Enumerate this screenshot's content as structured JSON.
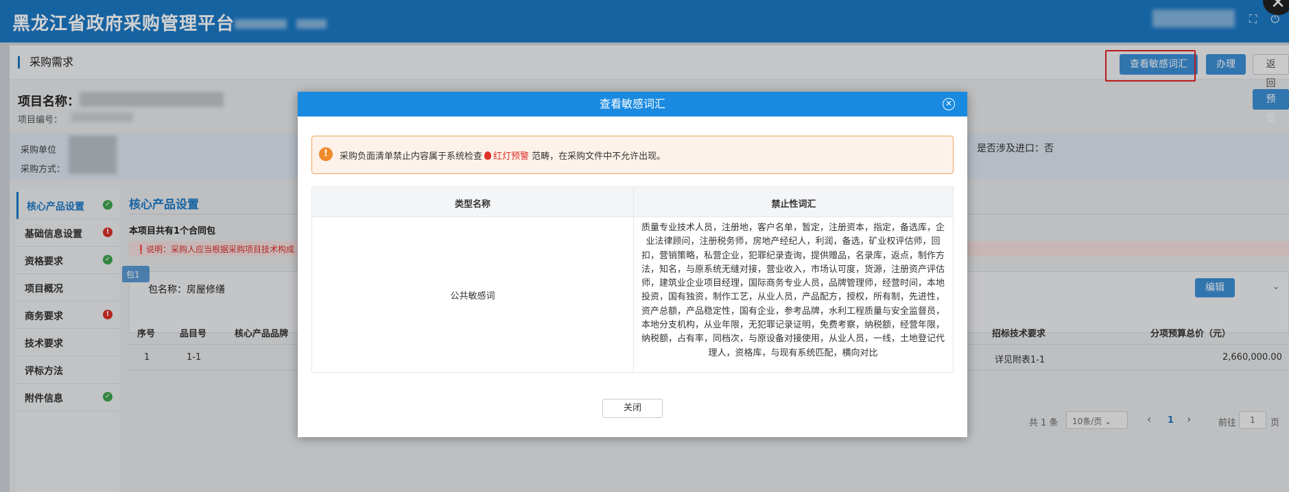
{
  "header": {
    "app_title": "黑龙江省政府采购管理平台",
    "icons": [
      "fullscreen-icon",
      "power-icon"
    ]
  },
  "page": {
    "card_title": "采购需求",
    "btn_view_sensitive": "查看敏感词汇",
    "btn_handle": "办理",
    "btn_back": "返回",
    "btn_preview": "预览",
    "project_name_label": "项目名称：",
    "project_code_label": "项目编号：",
    "purchase_unit_label": "采购单位",
    "purchase_method_label": "采购方式：",
    "import_text": "是否涉及进口：否"
  },
  "sidebar": {
    "items": [
      {
        "label": "核心产品设置",
        "status": "ok"
      },
      {
        "label": "基础信息设置",
        "status": "error"
      },
      {
        "label": "资格要求",
        "status": "ok"
      },
      {
        "label": "项目概况",
        "status": "none"
      },
      {
        "label": "商务要求",
        "status": "error"
      },
      {
        "label": "技术要求",
        "status": "none"
      },
      {
        "label": "评标方法",
        "status": "none"
      },
      {
        "label": "附件信息",
        "status": "ok"
      }
    ]
  },
  "main": {
    "section_title": "核心产品设置",
    "package_count": "本项目共有1个合同包",
    "warning": "说明：采购人应当根据采购项目技术构成",
    "package_tag": "包1",
    "package_name": "包名称：房屋修缮",
    "btn_edit": "编辑",
    "table": {
      "headers": [
        "序号",
        "品目号",
        "核心产品品牌",
        "招标技术要求",
        "分项预算总价（元）"
      ],
      "rows": [
        [
          "1",
          "1-1",
          "",
          "详见附表1-1",
          "2,660,000.00"
        ]
      ]
    },
    "pager": {
      "total": "共 1 条",
      "page_size": "10条/页",
      "prev": "‹",
      "current": "1",
      "next": "›",
      "goto_label": "前往",
      "goto_value": "1",
      "page_unit": "页"
    }
  },
  "dialog": {
    "title": "查看敏感词汇",
    "notice_before": "采购负面清单禁止内容属于系统检查",
    "notice_highlight": "红灯预警",
    "notice_after": "范畴，在采购文件中不允许出现。",
    "table_headers": [
      "类型名称",
      "禁止性词汇"
    ],
    "rows": [
      {
        "type": "公共敏感词",
        "words": "质量专业技术人员，注册地，客户名单，暂定，注册资本，指定，备选库，企业法律顾问，注册税务师，房地产经纪人，利润，备选，矿业权评估师，回扣，营销策略，私营企业，犯罪纪录查询，提供赠品，名录库，返点，制作方法，知名，与原系统无缝对接，营业收入，市场认可度，货源，注册资产评估师，建筑业企业项目经理，国际商务专业人员，品牌管理师，经营时间，本地投资，国有独资，制作工艺，从业人员，产品配方，授权，所有制，先进性，资产总额，产品稳定性，国有企业，参考品牌，水利工程质量与安全监督员，本地分支机构，从业年限，无犯罪记录证明，免费考察，纳税额，经营年限，纳税额，占有率，同档次，与原设备对接使用，从业人员，一线，土地登记代理人，资格库，与现有系统匹配，横向对比"
      }
    ],
    "btn_close": "关闭"
  },
  "colors": {
    "brand": "#1c79c6",
    "dialog_header": "#1a8ae0",
    "warning_red": "#e0302a",
    "notice_orange": "#f08a2a"
  }
}
